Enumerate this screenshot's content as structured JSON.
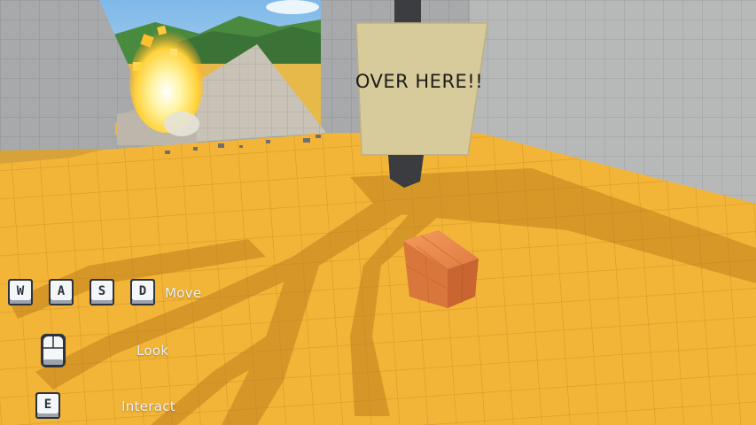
{
  "scene": {
    "sign_text": "OVER  HERE!!",
    "colors": {
      "sky": "#8fc6f0",
      "hills": "#3f7a3a",
      "floor": "#f2b233",
      "floor_shadow": "#b8791f",
      "walls": "#a9abab",
      "sign": "#d8cc9a",
      "crate": "#e8854a",
      "fire": "#ffd640"
    }
  },
  "controls": {
    "move": {
      "keys": [
        "W",
        "A",
        "S",
        "D"
      ],
      "label": "Move"
    },
    "look": {
      "icon": "mouse-icon",
      "label": "Look"
    },
    "interact": {
      "key": "E",
      "label": "Interact"
    }
  }
}
